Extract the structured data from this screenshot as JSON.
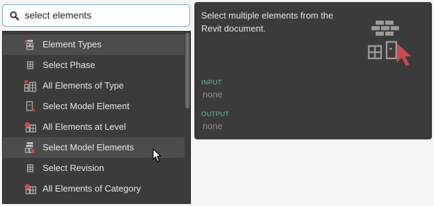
{
  "search": {
    "value": "select elements",
    "icon": "search-icon"
  },
  "results": {
    "items": [
      {
        "label": "Element Types",
        "icon": "element-types-icon",
        "hovered": true
      },
      {
        "label": "Select Phase",
        "icon": "select-phase-icon"
      },
      {
        "label": "All Elements of Type",
        "icon": "all-elements-of-type-icon"
      },
      {
        "label": "Select Model Element",
        "icon": "select-model-element-icon"
      },
      {
        "label": "All Elements at Level",
        "icon": "all-elements-at-level-icon"
      },
      {
        "label": "Select Model Elements",
        "icon": "select-model-elements-icon",
        "hovered": true
      },
      {
        "label": "Select Revision",
        "icon": "select-revision-icon"
      },
      {
        "label": "All Elements of Category",
        "icon": "all-elements-of-category-icon"
      }
    ]
  },
  "details": {
    "description": "Select multiple elements from the Revit document.",
    "input_label": "INPUT",
    "input_value": "none",
    "output_label": "OUTPUT",
    "output_value": "none",
    "icon": "select-model-elements-node-icon"
  },
  "colors": {
    "panel_bg": "#3b3b3b",
    "hover_bg": "#4c4c4c",
    "label_accent": "#5fbfa9",
    "icon_accent": "#c94a4a",
    "search_border": "#7aa7cf"
  }
}
